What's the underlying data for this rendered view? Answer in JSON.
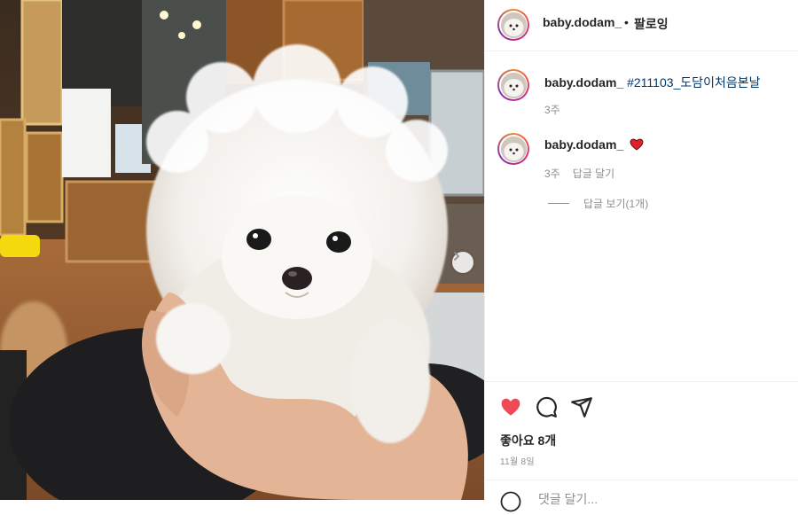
{
  "post": {
    "photo_alt": "white pomeranian puppy",
    "carousel_next_icon": "chevron-right-icon"
  },
  "header": {
    "username": "baby.dodam_",
    "separator": "•",
    "follow_label": "팔로잉"
  },
  "comments": [
    {
      "username": "baby.dodam_",
      "hashtag": "#211103_도담이처음본날",
      "time": "3주",
      "reply_label": ""
    },
    {
      "username": "baby.dodam_",
      "emoji": "heart-icon",
      "time": "3주",
      "reply_label": "답글 달기",
      "view_replies": "답글 보기(1개)"
    }
  ],
  "actions": {
    "like_icon": "heart-icon",
    "like_color": "#ed4956",
    "comment_icon": "comment-icon",
    "share_icon": "share-icon",
    "likes_text": "좋아요 8개",
    "date_text": "11월 8일"
  },
  "add_comment": {
    "placeholder": "댓글 달기..."
  },
  "colors": {
    "hashtag": "#00376b",
    "muted": "#8e8e8e",
    "text": "#262626"
  }
}
